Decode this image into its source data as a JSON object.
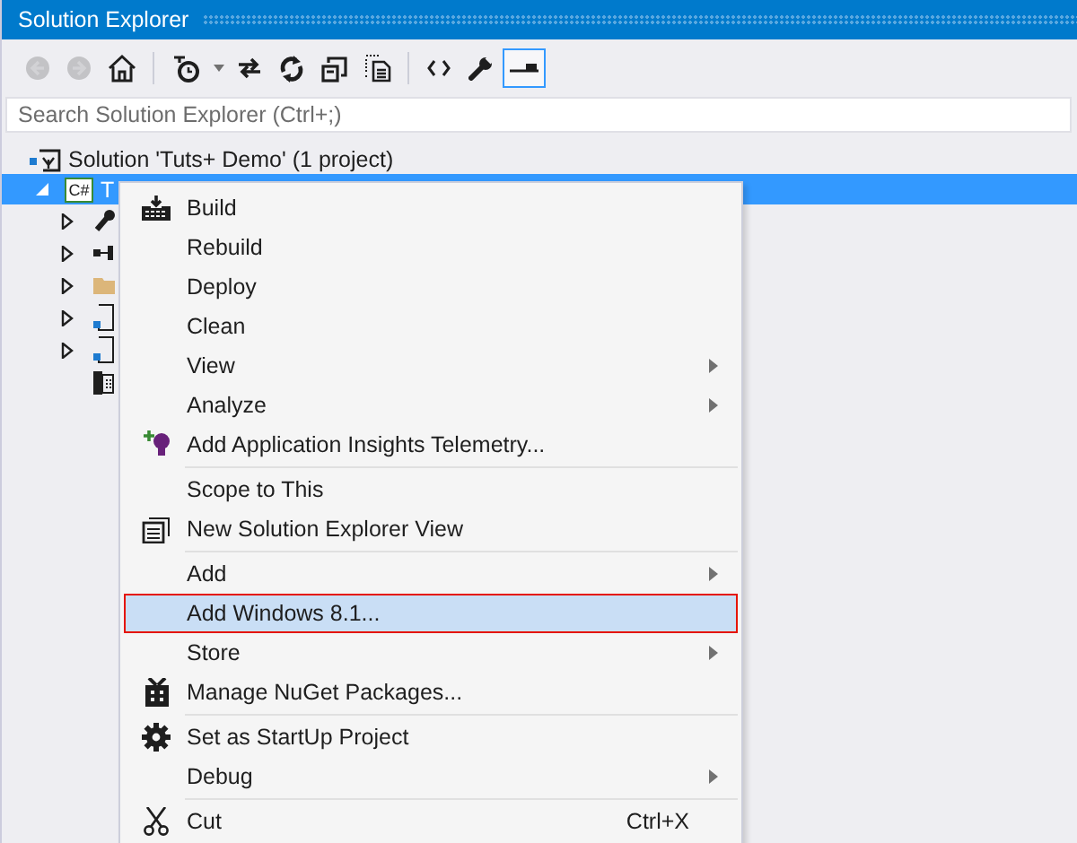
{
  "window": {
    "title": "Solution Explorer"
  },
  "toolbar": [
    {
      "kind": "back",
      "disabled": true,
      "selected": false
    },
    {
      "kind": "forward",
      "disabled": true,
      "selected": false
    },
    {
      "kind": "home",
      "disabled": false,
      "selected": false
    },
    {
      "kind": "sep"
    },
    {
      "kind": "pending",
      "disabled": false,
      "selected": false
    },
    {
      "kind": "dropdown",
      "disabled": false,
      "selected": false
    },
    {
      "kind": "sync",
      "disabled": false,
      "selected": false
    },
    {
      "kind": "refresh",
      "disabled": false,
      "selected": false
    },
    {
      "kind": "collapse",
      "disabled": false,
      "selected": false
    },
    {
      "kind": "files",
      "disabled": false,
      "selected": false
    },
    {
      "kind": "sep"
    },
    {
      "kind": "code",
      "disabled": false,
      "selected": false
    },
    {
      "kind": "wrench",
      "disabled": false,
      "selected": false
    },
    {
      "kind": "preview",
      "disabled": false,
      "selected": true
    }
  ],
  "search": {
    "placeholder": "Search Solution Explorer (Ctrl+;)"
  },
  "tree": {
    "label": "Solution 'Tuts+ Demo' (1 project)",
    "children": [
      {
        "label": "T",
        "badge": "C#",
        "kind": "csproj",
        "expanded": true,
        "selected": true,
        "children": [
          {
            "kind": "properties",
            "expanded": false
          },
          {
            "kind": "references",
            "expanded": false
          },
          {
            "kind": "folder",
            "expanded": false
          },
          {
            "kind": "xaml",
            "expanded": false
          },
          {
            "kind": "xaml",
            "expanded": false
          },
          {
            "kind": "manifest"
          }
        ]
      }
    ]
  },
  "menu": [
    [
      {
        "label": "Build",
        "kind": "build",
        "submenu": false,
        "selected": false
      },
      {
        "label": "Rebuild",
        "kind": "plain",
        "submenu": false,
        "selected": false
      },
      {
        "label": "Deploy",
        "kind": "plain",
        "submenu": false,
        "selected": false
      },
      {
        "label": "Clean",
        "kind": "plain",
        "submenu": false,
        "selected": false
      },
      {
        "label": "View",
        "kind": "plain",
        "submenu": true,
        "selected": false
      },
      {
        "label": "Analyze",
        "kind": "plain",
        "submenu": true,
        "selected": false
      },
      {
        "label": "Add Application Insights Telemetry...",
        "kind": "insights",
        "submenu": false,
        "selected": false
      }
    ],
    [
      {
        "label": "Scope to This",
        "kind": "plain",
        "submenu": false,
        "selected": false
      },
      {
        "label": "New Solution Explorer View",
        "kind": "newview",
        "submenu": false,
        "selected": false
      }
    ],
    [
      {
        "label": "Add",
        "kind": "plain",
        "submenu": true,
        "selected": false
      },
      {
        "label": "Add Windows 8.1...",
        "kind": "plain",
        "submenu": false,
        "selected": true
      },
      {
        "label": "Store",
        "kind": "plain",
        "submenu": true,
        "selected": false
      },
      {
        "label": "Manage NuGet Packages...",
        "kind": "nuget",
        "submenu": false,
        "selected": false
      }
    ],
    [
      {
        "label": "Set as StartUp Project",
        "kind": "gear",
        "submenu": false,
        "selected": false
      },
      {
        "label": "Debug",
        "kind": "plain",
        "submenu": true,
        "selected": false
      }
    ],
    [
      {
        "label": "Cut",
        "kind": "cut",
        "submenu": false,
        "selected": false,
        "shortcut": "Ctrl+X"
      }
    ]
  ]
}
